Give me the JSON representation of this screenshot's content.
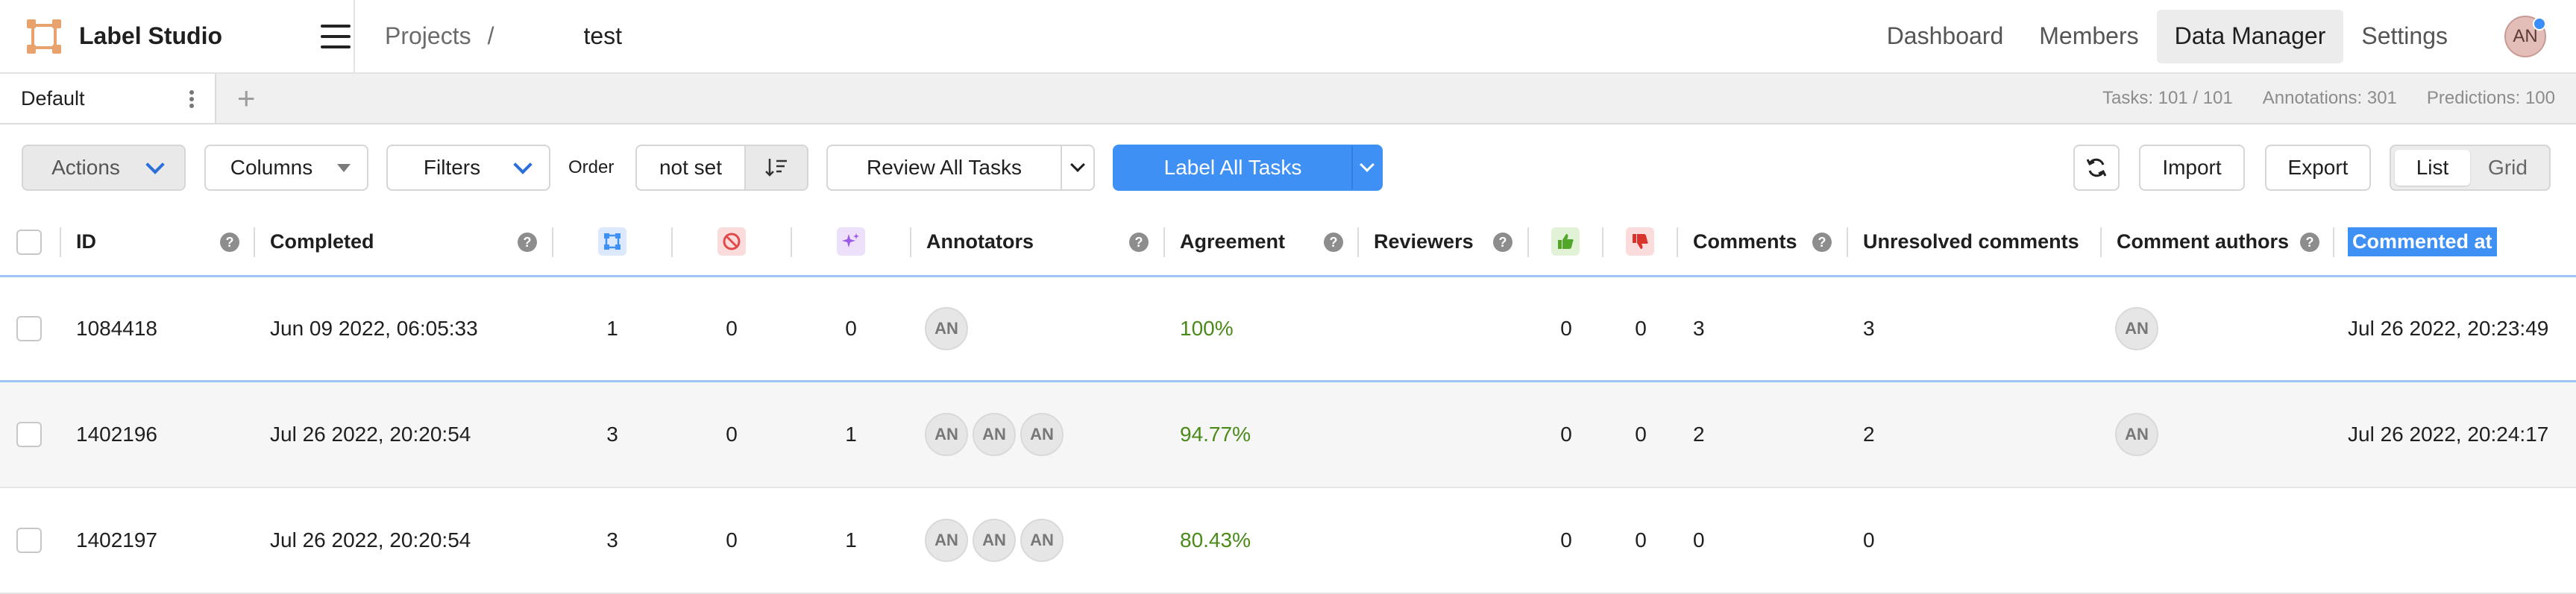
{
  "app": {
    "name": "Label Studio"
  },
  "breadcrumb": {
    "projects": "Projects",
    "separator": "/",
    "project": "test"
  },
  "nav": {
    "dashboard": "Dashboard",
    "members": "Members",
    "data_manager": "Data Manager",
    "settings": "Settings"
  },
  "user": {
    "initials": "AN"
  },
  "tabs": {
    "items": [
      {
        "label": "Default"
      }
    ],
    "add": "+"
  },
  "stats": {
    "tasks": "Tasks: 101 / 101",
    "annotations": "Annotations: 301",
    "predictions": "Predictions: 100"
  },
  "toolbar": {
    "actions": "Actions",
    "columns": "Columns",
    "filters": "Filters",
    "order_label": "Order",
    "order_value": "not set",
    "review_all": "Review All Tasks",
    "label_all": "Label All Tasks",
    "import": "Import",
    "export": "Export",
    "view_list": "List",
    "view_grid": "Grid"
  },
  "table": {
    "columns": {
      "id": "ID",
      "completed": "Completed",
      "annotators": "Annotators",
      "agreement": "Agreement",
      "reviewers": "Reviewers",
      "comments": "Comments",
      "unresolved": "Unresolved comments",
      "comment_authors": "Comment authors",
      "commented_at": "Commented at"
    },
    "help_glyph": "?",
    "rows": [
      {
        "id": "1084418",
        "completed": "Jun 09 2022, 06:05:33",
        "annotations": "1",
        "cancelled": "0",
        "predictions": "0",
        "annotators": [
          "AN"
        ],
        "agreement": "100%",
        "approved": "0",
        "rejected": "0",
        "comments": "3",
        "unresolved": "3",
        "comment_authors": [
          "AN"
        ],
        "commented_at": "Jul 26 2022, 20:23:49"
      },
      {
        "id": "1402196",
        "completed": "Jul 26 2022, 20:20:54",
        "annotations": "3",
        "cancelled": "0",
        "predictions": "1",
        "annotators": [
          "AN",
          "AN",
          "AN"
        ],
        "agreement": "94.77%",
        "approved": "0",
        "rejected": "0",
        "comments": "2",
        "unresolved": "2",
        "comment_authors": [
          "AN"
        ],
        "commented_at": "Jul 26 2022, 20:24:17"
      },
      {
        "id": "1402197",
        "completed": "Jul 26 2022, 20:20:54",
        "annotations": "3",
        "cancelled": "0",
        "predictions": "1",
        "annotators": [
          "AN",
          "AN",
          "AN"
        ],
        "agreement": "80.43%",
        "approved": "0",
        "rejected": "0",
        "comments": "0",
        "unresolved": "0",
        "comment_authors": [],
        "commented_at": ""
      }
    ]
  },
  "colors": {
    "accent": "#3e90f5",
    "agreement": "#4a8a18",
    "logo": "#e8a26d"
  }
}
